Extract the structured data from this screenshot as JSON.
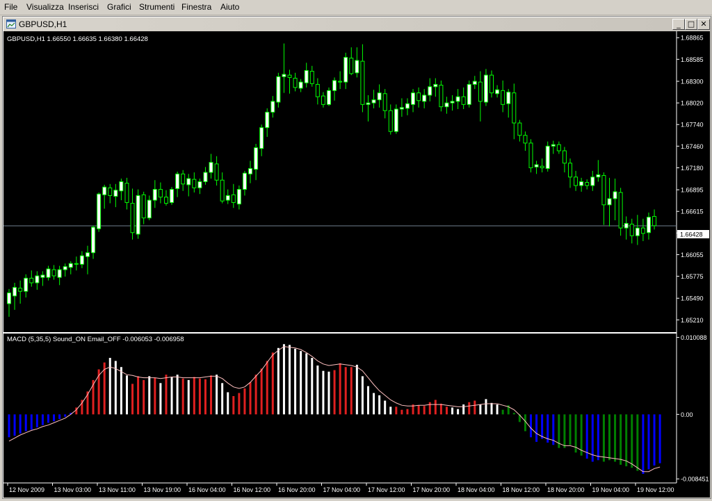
{
  "menu": [
    {
      "label": "File"
    },
    {
      "label": "Visualizza"
    },
    {
      "label": "Inserisci"
    },
    {
      "label": "Grafici"
    },
    {
      "label": "Strumenti"
    },
    {
      "label": "Finestra"
    },
    {
      "label": "Aiuto"
    }
  ],
  "window": {
    "title": "GBPUSD,H1",
    "minimize_glyph": "_",
    "maximize_glyph": "□",
    "close_glyph": "✕"
  },
  "price_panel": {
    "info": "GBPUSD,H1  1.66550 1.66635 1.66380 1.66428",
    "current_price_label": "1.66428"
  },
  "macd_panel": {
    "info": "MACD (5,35,5)  Sound_ON  Email_OFF  -0.006053 -0.006958"
  },
  "colors": {
    "background": "#000000",
    "candle": "#00ff00",
    "bull_body": "#ffffff",
    "bear_body": "#000000",
    "hist_red": "#e02020",
    "hist_white": "#ffffff",
    "hist_blue": "#0000ff",
    "hist_green": "#008000",
    "signal_line": "#ffc0c0",
    "bid_line": "#708090",
    "axis_text": "#ffffff",
    "frame_bg": "#d4d0c8"
  },
  "chart_data": [
    {
      "type": "candlestick",
      "title": "GBPUSD,H1",
      "ylim": [
        1.6506,
        1.6893
      ],
      "y_ticks": [
        "1.68865",
        "1.68585",
        "1.68300",
        "1.68020",
        "1.67740",
        "1.67460",
        "1.67180",
        "1.66895",
        "1.66615",
        "1.66335",
        "1.66055",
        "1.65775",
        "1.65490",
        "1.65210"
      ],
      "x_ticks": [
        "12 Nov 2009",
        "13 Nov 03:00",
        "13 Nov 11:00",
        "13 Nov 19:00",
        "16 Nov 04:00",
        "16 Nov 12:00",
        "16 Nov 20:00",
        "17 Nov 04:00",
        "17 Nov 12:00",
        "17 Nov 20:00",
        "18 Nov 04:00",
        "18 Nov 12:00",
        "18 Nov 20:00",
        "19 Nov 04:00",
        "19 Nov 12:00"
      ],
      "bid_price": 1.66428,
      "candles": [
        [
          1.6542,
          1.6561,
          1.6525,
          1.6556
        ],
        [
          1.6552,
          1.6569,
          1.6534,
          1.6563
        ],
        [
          1.6562,
          1.6572,
          1.6542,
          1.6558
        ],
        [
          1.6558,
          1.658,
          1.655,
          1.6575
        ],
        [
          1.6575,
          1.6585,
          1.6564,
          1.6569
        ],
        [
          1.6569,
          1.6584,
          1.656,
          1.6578
        ],
        [
          1.6576,
          1.6584,
          1.6565,
          1.6579
        ],
        [
          1.6576,
          1.6591,
          1.6572,
          1.6587
        ],
        [
          1.6586,
          1.6592,
          1.6573,
          1.6578
        ],
        [
          1.6576,
          1.6591,
          1.6566,
          1.6586
        ],
        [
          1.6586,
          1.6594,
          1.6577,
          1.659
        ],
        [
          1.6589,
          1.6597,
          1.658,
          1.6594
        ],
        [
          1.6594,
          1.6603,
          1.6585,
          1.6593
        ],
        [
          1.6593,
          1.661,
          1.6588,
          1.6604
        ],
        [
          1.6603,
          1.6617,
          1.658,
          1.6608
        ],
        [
          1.6608,
          1.6643,
          1.66,
          1.6641
        ],
        [
          1.6639,
          1.6686,
          1.6635,
          1.6684
        ],
        [
          1.6683,
          1.6696,
          1.6665,
          1.6693
        ],
        [
          1.6692,
          1.6697,
          1.6672,
          1.6682
        ],
        [
          1.6681,
          1.6697,
          1.6667,
          1.6689
        ],
        [
          1.6688,
          1.6704,
          1.6676,
          1.67
        ],
        [
          1.6698,
          1.6705,
          1.6664,
          1.6673
        ],
        [
          1.6672,
          1.6691,
          1.6625,
          1.6634
        ],
        [
          1.6632,
          1.669,
          1.6626,
          1.6682
        ],
        [
          1.6683,
          1.6687,
          1.6645,
          1.6653
        ],
        [
          1.6653,
          1.6682,
          1.665,
          1.6676
        ],
        [
          1.6676,
          1.6702,
          1.6666,
          1.669
        ],
        [
          1.669,
          1.6699,
          1.6672,
          1.668
        ],
        [
          1.668,
          1.6689,
          1.6669,
          1.6672
        ],
        [
          1.6673,
          1.6693,
          1.667,
          1.669
        ],
        [
          1.6691,
          1.6713,
          1.668,
          1.671
        ],
        [
          1.671,
          1.6715,
          1.6688,
          1.6697
        ],
        [
          1.6696,
          1.671,
          1.6681,
          1.6704
        ],
        [
          1.6703,
          1.6712,
          1.6686,
          1.6692
        ],
        [
          1.6692,
          1.6704,
          1.6684,
          1.67
        ],
        [
          1.67,
          1.6719,
          1.6696,
          1.6712
        ],
        [
          1.6712,
          1.6736,
          1.6704,
          1.6725
        ],
        [
          1.6723,
          1.6733,
          1.6695,
          1.6702
        ],
        [
          1.6702,
          1.6712,
          1.6672,
          1.6675
        ],
        [
          1.6676,
          1.669,
          1.6671,
          1.6682
        ],
        [
          1.6683,
          1.6697,
          1.6666,
          1.6673
        ],
        [
          1.6671,
          1.6695,
          1.6664,
          1.669
        ],
        [
          1.669,
          1.6714,
          1.6682,
          1.6711
        ],
        [
          1.671,
          1.6727,
          1.6698,
          1.6717
        ],
        [
          1.6716,
          1.6749,
          1.6702,
          1.6744
        ],
        [
          1.6743,
          1.6774,
          1.6733,
          1.677
        ],
        [
          1.677,
          1.6795,
          1.6758,
          1.679
        ],
        [
          1.679,
          1.6811,
          1.6783,
          1.6804
        ],
        [
          1.6803,
          1.6841,
          1.6796,
          1.6836
        ],
        [
          1.6836,
          1.6879,
          1.6815,
          1.6839
        ],
        [
          1.6838,
          1.6845,
          1.6814,
          1.6835
        ],
        [
          1.6834,
          1.6841,
          1.6817,
          1.6822
        ],
        [
          1.6821,
          1.6833,
          1.6816,
          1.6829
        ],
        [
          1.6828,
          1.6854,
          1.6822,
          1.6844
        ],
        [
          1.6843,
          1.685,
          1.6823,
          1.6827
        ],
        [
          1.6826,
          1.6834,
          1.68,
          1.681
        ],
        [
          1.6811,
          1.6816,
          1.6796,
          1.68
        ],
        [
          1.68,
          1.6822,
          1.6798,
          1.6818
        ],
        [
          1.6818,
          1.6835,
          1.6805,
          1.6831
        ],
        [
          1.683,
          1.6843,
          1.682,
          1.6829
        ],
        [
          1.6829,
          1.6867,
          1.682,
          1.6861
        ],
        [
          1.686,
          1.6874,
          1.6838,
          1.684
        ],
        [
          1.6841,
          1.6874,
          1.6835,
          1.6857
        ],
        [
          1.6856,
          1.6878,
          1.679,
          1.68
        ],
        [
          1.68,
          1.6812,
          1.6778,
          1.6802
        ],
        [
          1.6802,
          1.6819,
          1.6795,
          1.6806
        ],
        [
          1.6806,
          1.6826,
          1.6796,
          1.6815
        ],
        [
          1.6814,
          1.682,
          1.6782,
          1.6792
        ],
        [
          1.6792,
          1.68,
          1.6761,
          1.6765
        ],
        [
          1.6765,
          1.68,
          1.6762,
          1.6794
        ],
        [
          1.6794,
          1.6808,
          1.6784,
          1.6796
        ],
        [
          1.6795,
          1.6808,
          1.6786,
          1.6801
        ],
        [
          1.68,
          1.682,
          1.679,
          1.6815
        ],
        [
          1.6815,
          1.6822,
          1.6796,
          1.6805
        ],
        [
          1.6804,
          1.682,
          1.6795,
          1.6812
        ],
        [
          1.6812,
          1.6834,
          1.6804,
          1.6823
        ],
        [
          1.6823,
          1.6834,
          1.681,
          1.6826
        ],
        [
          1.6825,
          1.6831,
          1.6791,
          1.6797
        ],
        [
          1.6797,
          1.681,
          1.6788,
          1.6802
        ],
        [
          1.6802,
          1.6812,
          1.6792,
          1.6804
        ],
        [
          1.6804,
          1.682,
          1.6794,
          1.681
        ],
        [
          1.681,
          1.6822,
          1.6794,
          1.68
        ],
        [
          1.68,
          1.6831,
          1.6796,
          1.6826
        ],
        [
          1.6826,
          1.6837,
          1.682,
          1.683
        ],
        [
          1.6829,
          1.6843,
          1.6778,
          1.6804
        ],
        [
          1.6803,
          1.6846,
          1.6798,
          1.6838
        ],
        [
          1.6838,
          1.6844,
          1.6809,
          1.6815
        ],
        [
          1.6814,
          1.6825,
          1.6809,
          1.6819
        ],
        [
          1.6818,
          1.6831,
          1.679,
          1.68
        ],
        [
          1.6801,
          1.682,
          1.6783,
          1.6816
        ],
        [
          1.6815,
          1.6827,
          1.6755,
          1.6776
        ],
        [
          1.6776,
          1.678,
          1.6752,
          1.676
        ],
        [
          1.676,
          1.6765,
          1.674,
          1.675
        ],
        [
          1.675,
          1.6755,
          1.6712,
          1.6718
        ],
        [
          1.6719,
          1.6727,
          1.671,
          1.6722
        ],
        [
          1.672,
          1.673,
          1.6712,
          1.6718
        ],
        [
          1.6717,
          1.6752,
          1.6713,
          1.6746
        ],
        [
          1.6746,
          1.6753,
          1.6736,
          1.6748
        ],
        [
          1.6748,
          1.6752,
          1.6736,
          1.674
        ],
        [
          1.674,
          1.6745,
          1.6712,
          1.6724
        ],
        [
          1.6724,
          1.673,
          1.6692,
          1.6706
        ],
        [
          1.6706,
          1.6714,
          1.6688,
          1.6695
        ],
        [
          1.6695,
          1.6705,
          1.6687,
          1.67
        ],
        [
          1.6699,
          1.6703,
          1.669,
          1.6695
        ],
        [
          1.6695,
          1.6714,
          1.6688,
          1.6706
        ],
        [
          1.6706,
          1.6728,
          1.67,
          1.6709
        ],
        [
          1.6708,
          1.6712,
          1.6644,
          1.667
        ],
        [
          1.667,
          1.6705,
          1.6642,
          1.6678
        ],
        [
          1.6678,
          1.6704,
          1.665,
          1.6687
        ],
        [
          1.6686,
          1.6692,
          1.663,
          1.664
        ],
        [
          1.664,
          1.6655,
          1.6625,
          1.6646
        ],
        [
          1.6645,
          1.6652,
          1.662,
          1.663
        ],
        [
          1.663,
          1.6657,
          1.6618,
          1.664
        ],
        [
          1.664,
          1.6652,
          1.6623,
          1.6633
        ],
        [
          1.6634,
          1.666,
          1.6625,
          1.6654
        ],
        [
          1.6655,
          1.6664,
          1.6638,
          1.6643
        ]
      ]
    },
    {
      "type": "bar",
      "title": "MACD (5,35,5)",
      "ylim": [
        -0.0088,
        0.0105
      ],
      "y_ticks": [
        "0.010088",
        "0.00",
        "-0.008451"
      ],
      "values_note_colors": "color index per bar: r=red, w=white, b=blue, g=green",
      "values": [
        -0.003,
        -0.0028,
        -0.0025,
        -0.0022,
        -0.002,
        -0.0017,
        -0.0014,
        -0.0011,
        -0.0009,
        -0.0006,
        -0.0003,
        0.0002,
        0.0009,
        0.0019,
        0.003,
        0.0045,
        0.0059,
        0.0068,
        0.0074,
        0.007,
        0.0062,
        0.0051,
        0.004,
        0.005,
        0.0045,
        0.005,
        0.0048,
        0.0041,
        0.0052,
        0.0049,
        0.0052,
        0.0047,
        0.0045,
        0.0049,
        0.0047,
        0.0046,
        0.0051,
        0.0052,
        0.0041,
        0.0029,
        0.0024,
        0.0028,
        0.0034,
        0.0042,
        0.0052,
        0.006,
        0.007,
        0.0081,
        0.0087,
        0.0092,
        0.0091,
        0.0086,
        0.0083,
        0.008,
        0.0074,
        0.0064,
        0.0057,
        0.0056,
        0.0058,
        0.0067,
        0.0062,
        0.0062,
        0.0065,
        0.005,
        0.0037,
        0.0028,
        0.0025,
        0.0018,
        0.001,
        0.001,
        0.0006,
        0.0007,
        0.0013,
        0.0012,
        0.0011,
        0.0016,
        0.0019,
        0.0014,
        0.001,
        0.0009,
        0.0007,
        0.0013,
        0.0016,
        0.0018,
        0.0013,
        0.002,
        0.0015,
        0.0013,
        0.0006,
        0.0012,
        0.0002,
        -0.001,
        -0.0022,
        -0.003,
        -0.0036,
        -0.0032,
        -0.0037,
        -0.004,
        -0.0044,
        -0.0044,
        -0.004,
        -0.005,
        -0.0054,
        -0.0058,
        -0.0062,
        -0.006,
        -0.0062,
        -0.006,
        -0.0062,
        -0.0066,
        -0.0068,
        -0.007,
        -0.0074,
        -0.0078,
        -0.0072,
        -0.0067,
        -0.0064
      ],
      "bar_colors": "bbbbbbbbbbbbrrrrrrwwwwrrrwrwrwwrwrrrrwwwrrrrrrrrwwwwwwwwwwrrrrwwwwwwwrrrrrrrrrrwwwrrwwwwgggggbbbbbgggggbbbgggggggbbbb",
      "signal": [
        -0.0035,
        -0.0031,
        -0.0027,
        -0.0024,
        -0.0021,
        -0.0019,
        -0.0016,
        -0.0014,
        -0.0011,
        -0.0008,
        -0.0005,
        0.0,
        0.0006,
        0.0015,
        0.0026,
        0.0039,
        0.0051,
        0.0059,
        0.0062,
        0.006,
        0.0056,
        0.0052,
        0.0051,
        0.0049,
        0.0048,
        0.0048,
        0.0048,
        0.0047,
        0.0048,
        0.0049,
        0.0049,
        0.0048,
        0.0048,
        0.0048,
        0.0048,
        0.0049,
        0.005,
        0.005,
        0.0047,
        0.0041,
        0.0036,
        0.0034,
        0.0036,
        0.0042,
        0.005,
        0.0058,
        0.0068,
        0.0078,
        0.0084,
        0.0089,
        0.0088,
        0.0087,
        0.0085,
        0.0081,
        0.0076,
        0.007,
        0.0066,
        0.0064,
        0.0065,
        0.0066,
        0.0065,
        0.0064,
        0.0062,
        0.0057,
        0.0048,
        0.0039,
        0.0031,
        0.0025,
        0.0019,
        0.0015,
        0.0012,
        0.0011,
        0.0011,
        0.0012,
        0.0012,
        0.0013,
        0.0013,
        0.0013,
        0.0012,
        0.0011,
        0.001,
        0.001,
        0.0011,
        0.0012,
        0.0013,
        0.0014,
        0.0014,
        0.0014,
        0.0012,
        0.001,
        0.0006,
        -0.0001,
        -0.0009,
        -0.0018,
        -0.0025,
        -0.0029,
        -0.0032,
        -0.0034,
        -0.0038,
        -0.0041,
        -0.0041,
        -0.0043,
        -0.0047,
        -0.005,
        -0.0053,
        -0.0055,
        -0.0056,
        -0.0057,
        -0.0058,
        -0.0059,
        -0.0061,
        -0.0065,
        -0.007,
        -0.0075,
        -0.0075,
        -0.0071,
        -0.0069
      ]
    }
  ]
}
